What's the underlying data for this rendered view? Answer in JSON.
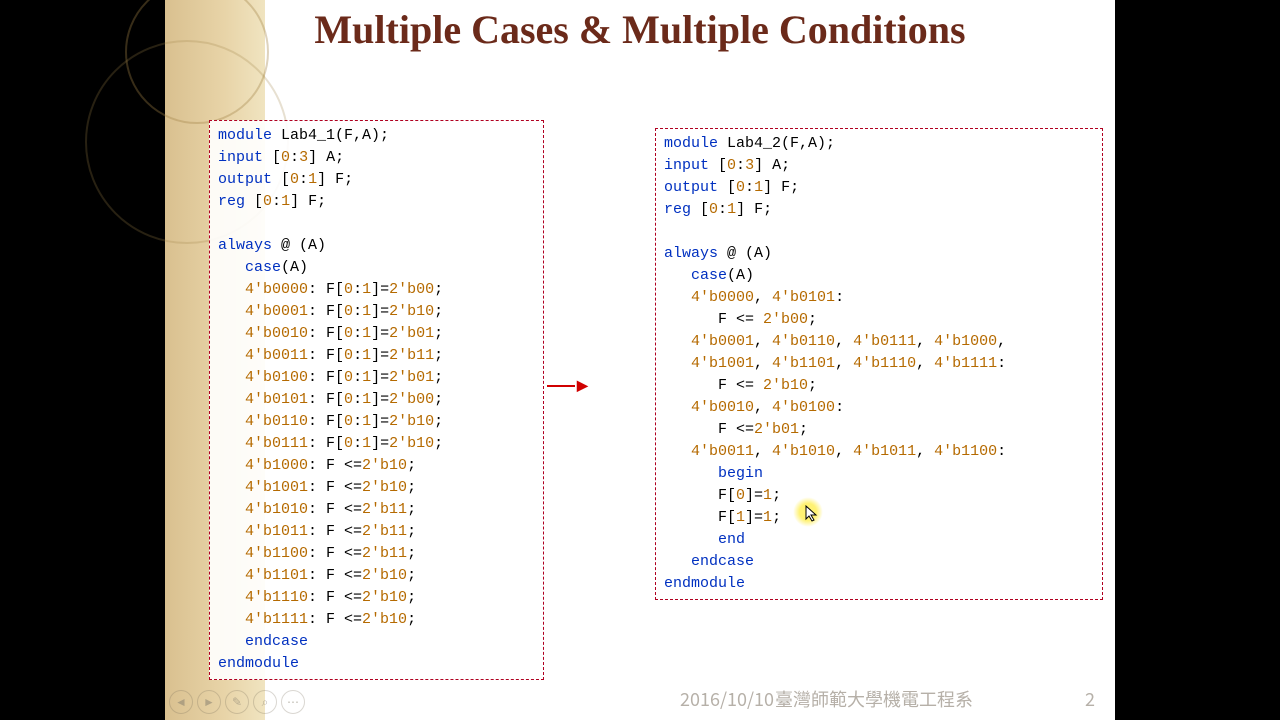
{
  "title": "Multiple Cases & Multiple Conditions",
  "left_code": "<span class='kw'>module</span> Lab4_1(F,A);\n<span class='kw'>input</span> [<span class='num'>0</span>:<span class='num'>3</span>] A;\n<span class='kw'>output</span> [<span class='num'>0</span>:<span class='num'>1</span>] F;\n<span class='kw'>reg</span> [<span class='num'>0</span>:<span class='num'>1</span>] F;\n\n<span class='kw'>always</span> @ (A)\n   <span class='kw'>case</span>(A)\n   <span class='num'>4'b0000</span>: F[<span class='num'>0</span>:<span class='num'>1</span>]=<span class='num'>2'b00</span>;\n   <span class='num'>4'b0001</span>: F[<span class='num'>0</span>:<span class='num'>1</span>]=<span class='num'>2'b10</span>;\n   <span class='num'>4'b0010</span>: F[<span class='num'>0</span>:<span class='num'>1</span>]=<span class='num'>2'b01</span>;\n   <span class='num'>4'b0011</span>: F[<span class='num'>0</span>:<span class='num'>1</span>]=<span class='num'>2'b11</span>;\n   <span class='num'>4'b0100</span>: F[<span class='num'>0</span>:<span class='num'>1</span>]=<span class='num'>2'b01</span>;\n   <span class='num'>4'b0101</span>: F[<span class='num'>0</span>:<span class='num'>1</span>]=<span class='num'>2'b00</span>;\n   <span class='num'>4'b0110</span>: F[<span class='num'>0</span>:<span class='num'>1</span>]=<span class='num'>2'b10</span>;\n   <span class='num'>4'b0111</span>: F[<span class='num'>0</span>:<span class='num'>1</span>]=<span class='num'>2'b10</span>;\n   <span class='num'>4'b1000</span>: F <=<span class='num'>2'b10</span>;\n   <span class='num'>4'b1001</span>: F <=<span class='num'>2'b10</span>;\n   <span class='num'>4'b1010</span>: F <=<span class='num'>2'b11</span>;\n   <span class='num'>4'b1011</span>: F <=<span class='num'>2'b11</span>;\n   <span class='num'>4'b1100</span>: F <=<span class='num'>2'b11</span>;\n   <span class='num'>4'b1101</span>: F <=<span class='num'>2'b10</span>;\n   <span class='num'>4'b1110</span>: F <=<span class='num'>2'b10</span>;\n   <span class='num'>4'b1111</span>: F <=<span class='num'>2'b10</span>;\n   <span class='kw'>endcase</span>\n<span class='kw'>endmodule</span>",
  "right_code": "<span class='kw'>module</span> Lab4_2(F,A);\n<span class='kw'>input</span> [<span class='num'>0</span>:<span class='num'>3</span>] A;\n<span class='kw'>output</span> [<span class='num'>0</span>:<span class='num'>1</span>] F;\n<span class='kw'>reg</span> [<span class='num'>0</span>:<span class='num'>1</span>] F;\n\n<span class='kw'>always</span> @ (A)\n   <span class='kw'>case</span>(A)\n   <span class='num'>4'b0000</span>, <span class='num'>4'b0101</span>:\n      F <= <span class='num'>2'b00</span>;\n   <span class='num'>4'b0001</span>, <span class='num'>4'b0110</span>, <span class='num'>4'b0111</span>, <span class='num'>4'b1000</span>,\n   <span class='num'>4'b1001</span>, <span class='num'>4'b1101</span>, <span class='num'>4'b1110</span>, <span class='num'>4'b1111</span>:\n      F <= <span class='num'>2'b10</span>;\n   <span class='num'>4'b0010</span>, <span class='num'>4'b0100</span>:\n      F <=<span class='num'>2'b01</span>;\n   <span class='num'>4'b0011</span>, <span class='num'>4'b1010</span>, <span class='num'>4'b1011</span>, <span class='num'>4'b1100</span>:\n      <span class='kw'>begin</span>\n      F[<span class='num'>0</span>]=<span class='num'>1</span>;\n      F[<span class='num'>1</span>]=<span class='num'>1</span>;\n      <span class='kw'>end</span>\n   <span class='kw'>endcase</span>\n<span class='kw'>endmodule</span>",
  "footer": {
    "date": "2016/10/10",
    "org": "臺灣師範大學機電工程系",
    "page": "2"
  }
}
